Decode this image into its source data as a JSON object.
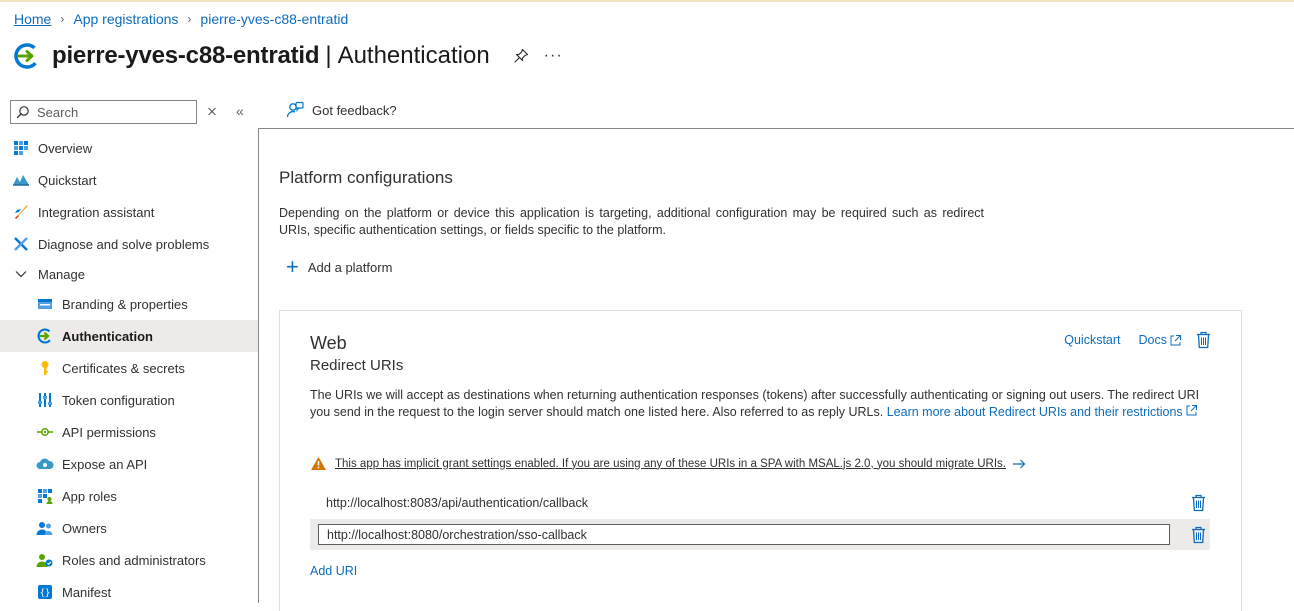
{
  "breadcrumb": {
    "home": "Home",
    "app_registrations": "App registrations",
    "current": "pierre-yves-c88-entratid"
  },
  "header": {
    "app_name": "pierre-yves-c88-entratid",
    "separator": "|",
    "page": "Authentication",
    "more": "···"
  },
  "search": {
    "placeholder": "Search"
  },
  "toolbar": {
    "feedback": "Got feedback?"
  },
  "nav": {
    "overview": "Overview",
    "quickstart": "Quickstart",
    "integration_assistant": "Integration assistant",
    "diagnose": "Diagnose and solve problems",
    "manage": "Manage",
    "branding": "Branding & properties",
    "authentication": "Authentication",
    "certificates": "Certificates & secrets",
    "token_config": "Token configuration",
    "api_permissions": "API permissions",
    "expose_api": "Expose an API",
    "app_roles": "App roles",
    "owners": "Owners",
    "roles_admins": "Roles and administrators",
    "manifest": "Manifest"
  },
  "main": {
    "section_title": "Platform configurations",
    "section_desc": "Depending on the platform or device this application is targeting, additional configuration may be required such as redirect URIs, specific authentication settings, or fields specific to the platform.",
    "add_platform": "Add a platform"
  },
  "web_card": {
    "title": "Web",
    "subtitle": "Redirect URIs",
    "quickstart": "Quickstart",
    "docs": "Docs",
    "desc": "The URIs we will accept as destinations when returning authentication responses (tokens) after successfully authenticating or signing out users. The redirect URI you send in the request to the login server should match one listed here. Also referred to as reply URLs.",
    "learn_more": "Learn more about Redirect URIs and their restrictions",
    "warning": "This app has implicit grant settings enabled. If you are using any of these URIs in a SPA with MSAL.js 2.0, you should migrate URIs.",
    "uris": [
      "http://localhost:8083/api/authentication/callback",
      "http://localhost:8080/orchestration/sso-callback"
    ],
    "add_uri": "Add URI"
  },
  "colors": {
    "accent": "#0f6cbd",
    "selected_bg": "#edebe9",
    "warning": "#d47500"
  }
}
